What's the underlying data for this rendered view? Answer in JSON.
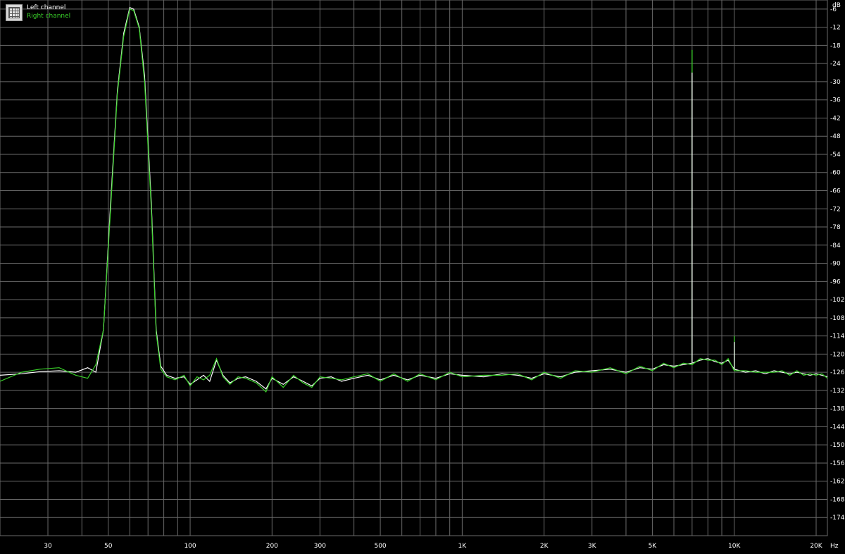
{
  "legend": {
    "left_label": "Left channel",
    "right_label": "Right channel",
    "left_color": "#ffffff",
    "right_color": "#39d029"
  },
  "colors": {
    "background": "#000000",
    "grid": "#6a6a6a",
    "tick_text": "#ffffff"
  },
  "chart_data": {
    "type": "line",
    "xscale": "log",
    "xlim": [
      20,
      22000
    ],
    "ylim": [
      -180,
      -3
    ],
    "y_unit": "dB",
    "x_unit": "Hz",
    "grid": true,
    "legend_position": "top-left",
    "y_ticks": [
      -6,
      -12,
      -18,
      -24,
      -30,
      -36,
      -42,
      -48,
      -54,
      -60,
      -66,
      -72,
      -78,
      -84,
      -90,
      -96,
      -102,
      -108,
      -114,
      -120,
      -126,
      -132,
      -138,
      -144,
      -150,
      -156,
      -162,
      -168,
      -174
    ],
    "x_ticks": [
      {
        "value": 30,
        "label": "30"
      },
      {
        "value": 50,
        "label": "50"
      },
      {
        "value": 100,
        "label": "100"
      },
      {
        "value": 200,
        "label": "200"
      },
      {
        "value": 300,
        "label": "300"
      },
      {
        "value": 500,
        "label": "500"
      },
      {
        "value": 1000,
        "label": "1K"
      },
      {
        "value": 2000,
        "label": "2K"
      },
      {
        "value": 3000,
        "label": "3K"
      },
      {
        "value": 5000,
        "label": "5K"
      },
      {
        "value": 10000,
        "label": "10K"
      },
      {
        "value": 20000,
        "label": "20K"
      }
    ],
    "series": [
      {
        "name": "Left channel",
        "color": "#ffffff",
        "points": [
          [
            20,
            -127.0
          ],
          [
            24,
            -126.5
          ],
          [
            28,
            -125.8
          ],
          [
            33,
            -125.5
          ],
          [
            38,
            -126.0
          ],
          [
            42,
            -124.5
          ],
          [
            45,
            -126.0
          ],
          [
            48,
            -112.0
          ],
          [
            51,
            -70.0
          ],
          [
            54,
            -33.0
          ],
          [
            57,
            -14.0
          ],
          [
            60,
            -5.5
          ],
          [
            62,
            -6.0
          ],
          [
            65,
            -12.0
          ],
          [
            68,
            -28.0
          ],
          [
            72,
            -70.0
          ],
          [
            75,
            -112.0
          ],
          [
            78,
            -124.0
          ],
          [
            82,
            -127.0
          ],
          [
            88,
            -128.0
          ],
          [
            95,
            -127.5
          ],
          [
            100,
            -130.0
          ],
          [
            106,
            -128.5
          ],
          [
            112,
            -127.0
          ],
          [
            118,
            -129.0
          ],
          [
            125,
            -122.0
          ],
          [
            132,
            -127.0
          ],
          [
            140,
            -129.5
          ],
          [
            150,
            -128.0
          ],
          [
            160,
            -127.5
          ],
          [
            175,
            -129.0
          ],
          [
            190,
            -131.5
          ],
          [
            200,
            -128.0
          ],
          [
            220,
            -130.0
          ],
          [
            240,
            -127.5
          ],
          [
            260,
            -129.0
          ],
          [
            280,
            -130.5
          ],
          [
            300,
            -128.0
          ],
          [
            330,
            -127.5
          ],
          [
            360,
            -129.0
          ],
          [
            400,
            -128.0
          ],
          [
            450,
            -127.0
          ],
          [
            500,
            -128.5
          ],
          [
            560,
            -127.0
          ],
          [
            630,
            -128.5
          ],
          [
            700,
            -127.0
          ],
          [
            800,
            -128.0
          ],
          [
            900,
            -126.5
          ],
          [
            1000,
            -127.0
          ],
          [
            1200,
            -127.5
          ],
          [
            1400,
            -126.5
          ],
          [
            1600,
            -127.0
          ],
          [
            1800,
            -128.0
          ],
          [
            2000,
            -126.5
          ],
          [
            2300,
            -127.5
          ],
          [
            2600,
            -126.0
          ],
          [
            3000,
            -125.5
          ],
          [
            3500,
            -125.0
          ],
          [
            4000,
            -126.0
          ],
          [
            4500,
            -124.5
          ],
          [
            5000,
            -125.0
          ],
          [
            5500,
            -123.5
          ],
          [
            6000,
            -124.0
          ],
          [
            6500,
            -123.5
          ],
          [
            7000,
            -123.0
          ],
          [
            7500,
            -122.0
          ],
          [
            8000,
            -121.5
          ],
          [
            8500,
            -122.5
          ],
          [
            9000,
            -123.0
          ],
          [
            9500,
            -122.0
          ],
          [
            10000,
            -125.0
          ],
          [
            11000,
            -126.0
          ],
          [
            12000,
            -125.5
          ],
          [
            13000,
            -126.5
          ],
          [
            14000,
            -125.5
          ],
          [
            15000,
            -126.0
          ],
          [
            16000,
            -126.5
          ],
          [
            17000,
            -126.0
          ],
          [
            18000,
            -126.5
          ],
          [
            19000,
            -127.0
          ],
          [
            20000,
            -126.5
          ],
          [
            21000,
            -127.0
          ],
          [
            22000,
            -127.5
          ]
        ]
      },
      {
        "name": "Right channel",
        "color": "#39d029",
        "points": [
          [
            20,
            -129.0
          ],
          [
            24,
            -126.0
          ],
          [
            28,
            -125.0
          ],
          [
            33,
            -124.5
          ],
          [
            38,
            -127.0
          ],
          [
            42,
            -128.0
          ],
          [
            45,
            -123.5
          ],
          [
            48,
            -112.0
          ],
          [
            51,
            -72.0
          ],
          [
            54,
            -34.0
          ],
          [
            57,
            -15.0
          ],
          [
            60,
            -6.0
          ],
          [
            62,
            -6.5
          ],
          [
            65,
            -12.5
          ],
          [
            68,
            -30.0
          ],
          [
            72,
            -72.0
          ],
          [
            75,
            -113.0
          ],
          [
            78,
            -125.0
          ],
          [
            82,
            -127.5
          ],
          [
            88,
            -128.5
          ],
          [
            95,
            -127.0
          ],
          [
            100,
            -130.5
          ],
          [
            106,
            -127.5
          ],
          [
            112,
            -128.5
          ],
          [
            118,
            -127.0
          ],
          [
            125,
            -121.5
          ],
          [
            132,
            -127.5
          ],
          [
            140,
            -130.0
          ],
          [
            150,
            -127.5
          ],
          [
            160,
            -128.0
          ],
          [
            175,
            -129.5
          ],
          [
            190,
            -132.5
          ],
          [
            200,
            -127.5
          ],
          [
            220,
            -131.0
          ],
          [
            240,
            -127.0
          ],
          [
            260,
            -129.5
          ],
          [
            280,
            -131.0
          ],
          [
            300,
            -127.5
          ],
          [
            330,
            -128.0
          ],
          [
            360,
            -128.5
          ],
          [
            400,
            -127.5
          ],
          [
            450,
            -126.5
          ],
          [
            500,
            -129.0
          ],
          [
            560,
            -126.5
          ],
          [
            630,
            -129.0
          ],
          [
            700,
            -126.5
          ],
          [
            800,
            -128.5
          ],
          [
            900,
            -126.0
          ],
          [
            1000,
            -127.5
          ],
          [
            1200,
            -127.0
          ],
          [
            1400,
            -127.0
          ],
          [
            1600,
            -126.5
          ],
          [
            1800,
            -128.5
          ],
          [
            2000,
            -126.0
          ],
          [
            2300,
            -128.0
          ],
          [
            2600,
            -125.5
          ],
          [
            3000,
            -126.0
          ],
          [
            3500,
            -124.5
          ],
          [
            4000,
            -126.5
          ],
          [
            4500,
            -124.0
          ],
          [
            5000,
            -125.5
          ],
          [
            5500,
            -123.0
          ],
          [
            6000,
            -124.5
          ],
          [
            6500,
            -123.0
          ],
          [
            7000,
            -123.5
          ],
          [
            7500,
            -121.5
          ],
          [
            8000,
            -122.0
          ],
          [
            8500,
            -122.0
          ],
          [
            9000,
            -123.5
          ],
          [
            9500,
            -121.5
          ],
          [
            10000,
            -125.5
          ],
          [
            11000,
            -125.5
          ],
          [
            12000,
            -126.0
          ],
          [
            13000,
            -126.0
          ],
          [
            14000,
            -126.0
          ],
          [
            15000,
            -125.5
          ],
          [
            16000,
            -127.0
          ],
          [
            17000,
            -125.5
          ],
          [
            18000,
            -127.0
          ],
          [
            19000,
            -126.5
          ],
          [
            20000,
            -127.0
          ],
          [
            21000,
            -126.5
          ],
          [
            22000,
            -128.0
          ]
        ]
      }
    ],
    "spikes": [
      {
        "series": "Right channel",
        "x": 7000,
        "y": -19.5
      },
      {
        "series": "Left channel",
        "x": 7000,
        "y": -27.0
      },
      {
        "series": "Right channel",
        "x": 10000,
        "y": -114.0
      },
      {
        "series": "Left channel",
        "x": 10000,
        "y": -116.0
      }
    ]
  }
}
